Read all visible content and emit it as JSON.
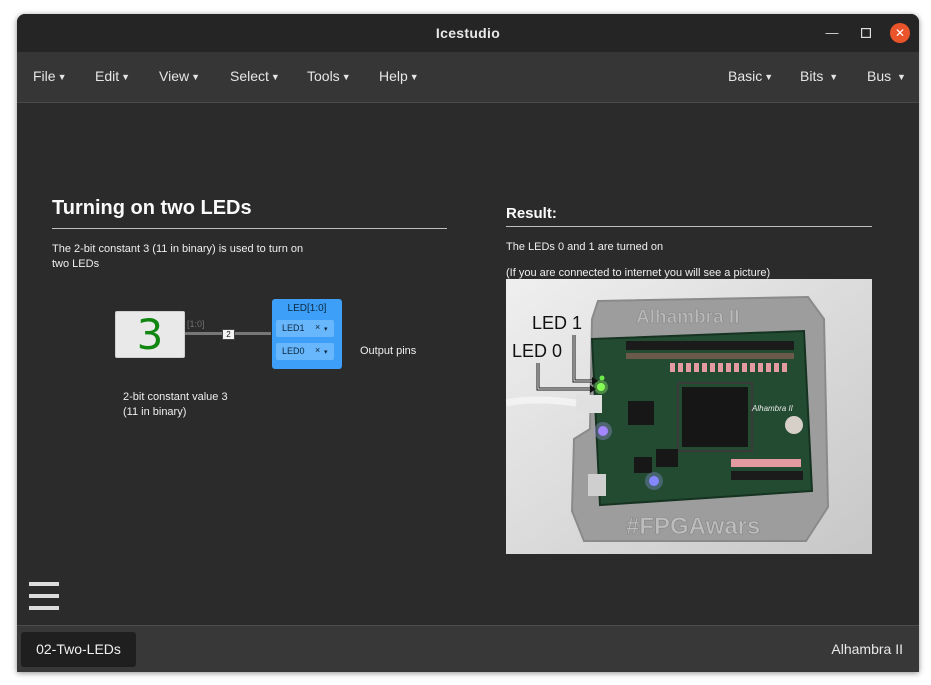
{
  "window": {
    "title": "Icestudio"
  },
  "menu": {
    "left": [
      "File",
      "Edit",
      "View",
      "Select",
      "Tools",
      "Help"
    ],
    "right": [
      "Basic",
      "Bits",
      "Bus"
    ]
  },
  "left_panel": {
    "heading": "Turning on two LEDs",
    "description_line1": "The 2-bit constant 3 (11 in binary) is used to turn on",
    "description_line2": "two LEDs",
    "constant_value": "3",
    "constant_caption_line1": "2-bit constant value 3",
    "constant_caption_line2": "(11 in binary)",
    "wire_range": "[1:0]",
    "bus_width": "2",
    "output_block_label": "LED[1:0]",
    "pins": [
      {
        "name": "LED1",
        "clear": "×",
        "dropdown": "▾"
      },
      {
        "name": "LED0",
        "clear": "×",
        "dropdown": "▾"
      }
    ],
    "output_caption": "Output pins"
  },
  "right_panel": {
    "heading": "Result:",
    "line1": "The LEDs 0 and 1 are turned on",
    "line2": "(If you are connected to internet you will see a picture)",
    "photo": {
      "label_led1": "LED 1",
      "label_led0": "LED 0",
      "board_title": "Alhambra II",
      "board_silk": "Alhambra II",
      "hashtag": "#FPGAwars"
    }
  },
  "statusbar": {
    "file_tab": "02-Two-LEDs",
    "board": "Alhambra II"
  },
  "icons": {
    "minimize": "minimize-icon",
    "maximize": "maximize-icon",
    "close": "close-icon",
    "menu": "hamburger-icon"
  },
  "colors": {
    "accent_close": "#e9542b",
    "constant_text": "#118711",
    "output_block": "#3d9ff8"
  }
}
